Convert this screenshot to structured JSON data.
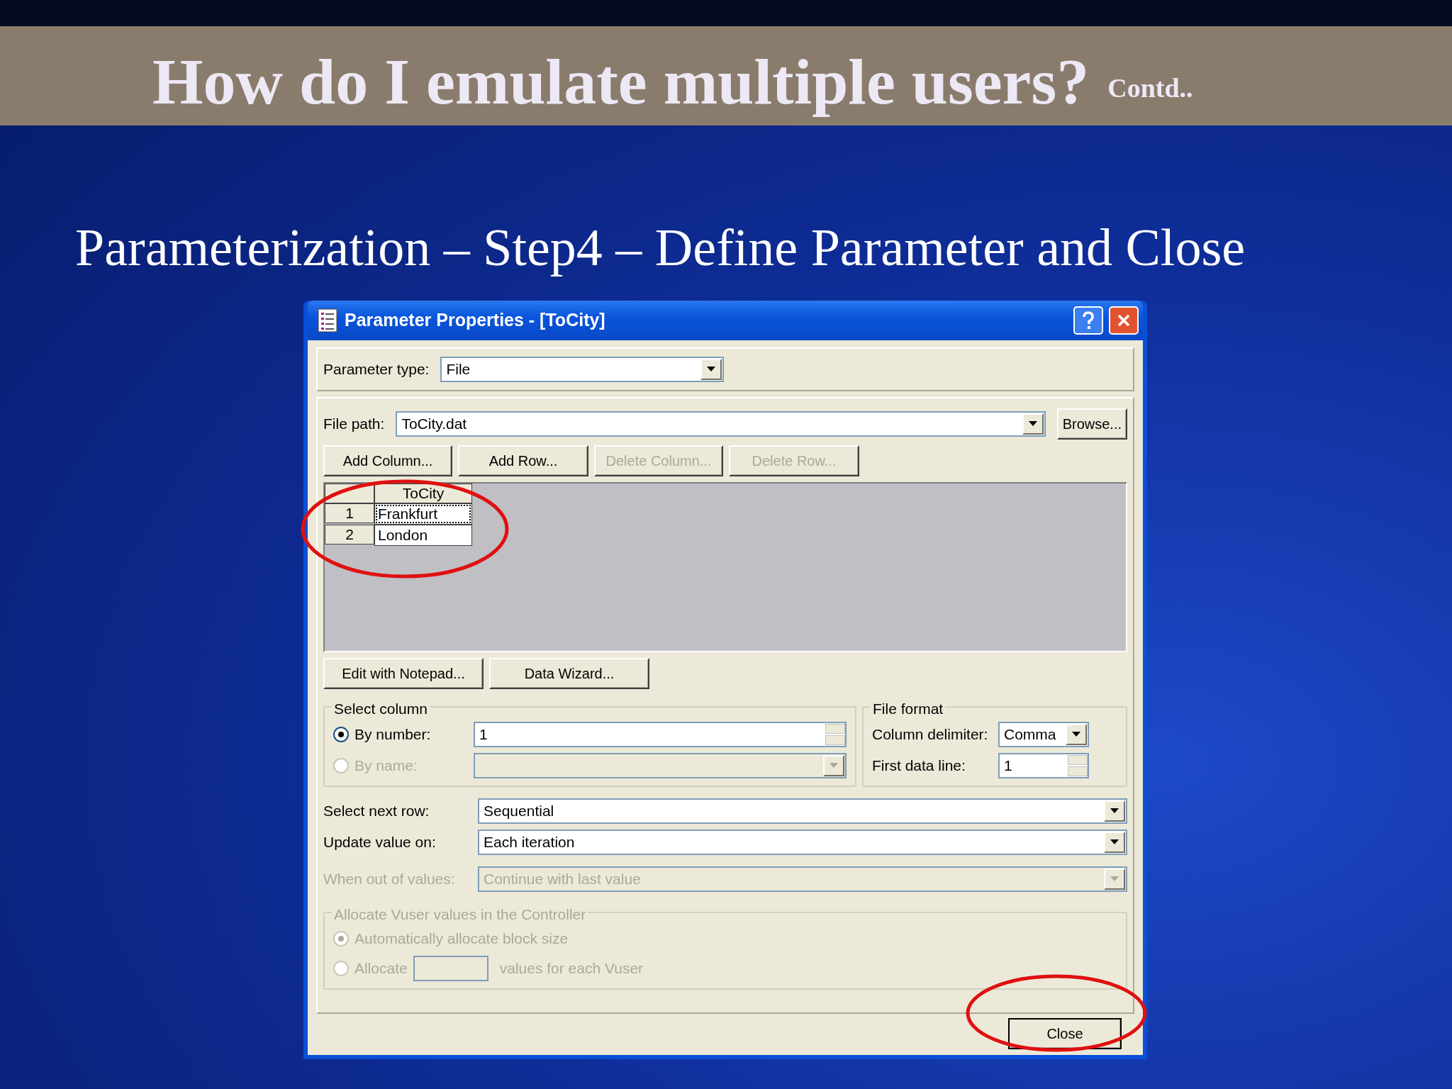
{
  "slide": {
    "title": "How do I emulate multiple users?",
    "title_suffix": "Contd..",
    "subtitle": "Parameterization – Step4 – Define Parameter and Close"
  },
  "window": {
    "title": "Parameter Properties - [ToCity]"
  },
  "parameter_type": {
    "label": "Parameter type:",
    "value": "File"
  },
  "file_path": {
    "label": "File path:",
    "value": "ToCity.dat",
    "button": "Browse..."
  },
  "table_buttons": [
    {
      "label": "Add Column...",
      "disabled": false
    },
    {
      "label": "Add Row...",
      "disabled": false
    },
    {
      "label": "Delete Column...",
      "disabled": true
    },
    {
      "label": "Delete Row...",
      "disabled": true
    }
  ],
  "table": {
    "columns": [
      "ToCity"
    ],
    "rows": [
      {
        "number": "1",
        "value": "Frankfurt",
        "selected": true
      },
      {
        "number": "2",
        "value": "London",
        "selected": false
      }
    ]
  },
  "edit_buttons": [
    "Edit with Notepad...",
    "Data Wizard..."
  ],
  "select_column": {
    "title": "Select column",
    "options": [
      {
        "kind": "spin",
        "label": "By number:",
        "value": "1",
        "selected": true,
        "disabled": false
      },
      {
        "kind": "combo",
        "label": "By name:",
        "selected": false,
        "disabled": true
      }
    ]
  },
  "file_format": {
    "title": "File format",
    "fields": [
      {
        "kind": "combo",
        "label": "Column delimiter:",
        "value": "Comma"
      },
      {
        "kind": "spin",
        "label": "First data line:",
        "value": "1"
      }
    ]
  },
  "row_settings": [
    {
      "label": "Select next row:",
      "value": "Sequential",
      "disabled": false
    },
    {
      "label": "Update value on:",
      "value": "Each iteration",
      "disabled": false
    },
    {
      "label": "When out of values:",
      "value": "Continue with last value",
      "disabled": true
    }
  ],
  "allocate": {
    "title": "Allocate Vuser values in the Controller",
    "disabled": true,
    "options": [
      {
        "label": "Automatically allocate block size",
        "selected": true
      },
      {
        "label": "Allocate",
        "suffix": "values for each Vuser",
        "selected": false
      }
    ]
  },
  "close_button": "Close"
}
